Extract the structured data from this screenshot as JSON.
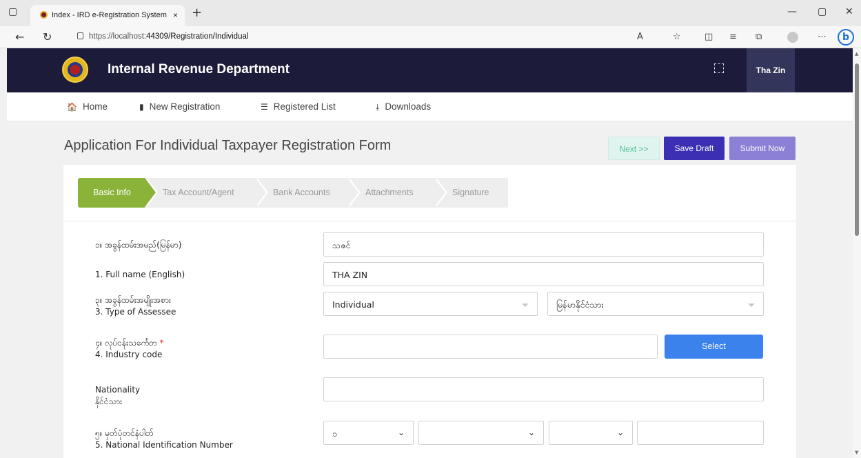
{
  "browser": {
    "tab_title": "Index - IRD e-Registration System",
    "tab_close": "×",
    "new_tab": "+",
    "url_host": "https://localhost",
    "url_rest": ":44309/Registration/Individual",
    "window_controls": [
      "—",
      "▢",
      "✕"
    ]
  },
  "header": {
    "brand": "Internal Revenue Department",
    "user": "Tha Zin"
  },
  "menu": {
    "items": [
      {
        "label": "Home",
        "icon": "home-icon",
        "glyph": "🏠"
      },
      {
        "label": "New Registration",
        "icon": "document-icon",
        "glyph": "▮"
      },
      {
        "label": "Registered List",
        "icon": "list-icon",
        "glyph": "☰"
      },
      {
        "label": "Downloads",
        "icon": "download-icon",
        "glyph": "⤓"
      }
    ]
  },
  "page": {
    "title": "Application For Individual Taxpayer Registration Form",
    "buttons": {
      "next": "Next >>",
      "save_draft": "Save Draft",
      "submit": "Submit Now"
    }
  },
  "steps": [
    "Basic Info",
    "Tax Account/Agent",
    "Bank Accounts",
    "Attachments",
    "Signature"
  ],
  "form": {
    "full_name_mm_label": "၁။ အခွန်ထမ်းအမည်(မြန်မာ)",
    "full_name_mm_value": "သဇင်",
    "full_name_en_label": "1. Full name (English)",
    "full_name_en_value": "THA ZIN",
    "assessee_label_mm": "၃။ အခွန်ထမ်းအမျိုးအစား",
    "assessee_label_en": "3. Type of Assessee",
    "assessee_type": "Individual",
    "assessee_citizenship": "မြန်မာနိုင်ငံသား",
    "industry_label_mm": "၄။ လုပ်ငန်းသင်္ကေတ",
    "industry_required": "*",
    "industry_label_en": "4. Industry code",
    "industry_value": "",
    "select_button": "Select",
    "nationality_label_en": "Nationality",
    "nationality_label_mm": "နိုင်ငံသား",
    "nationality_value": "",
    "nrc_label_mm": "၅။ မှတ်ပုံတင်နံပါတ်",
    "nrc_label_en": "5. National Identification Number",
    "nrc_state": "၁",
    "nrc_separator": "/",
    "nrc_township": "",
    "nrc_type": "",
    "nrc_number": ""
  },
  "colors": {
    "header_bg": "#1c1c3a",
    "active_step": "#8bb33a",
    "save_draft": "#3b2fb3",
    "submit": "#8b80d6",
    "select_button": "#3b82ec"
  }
}
